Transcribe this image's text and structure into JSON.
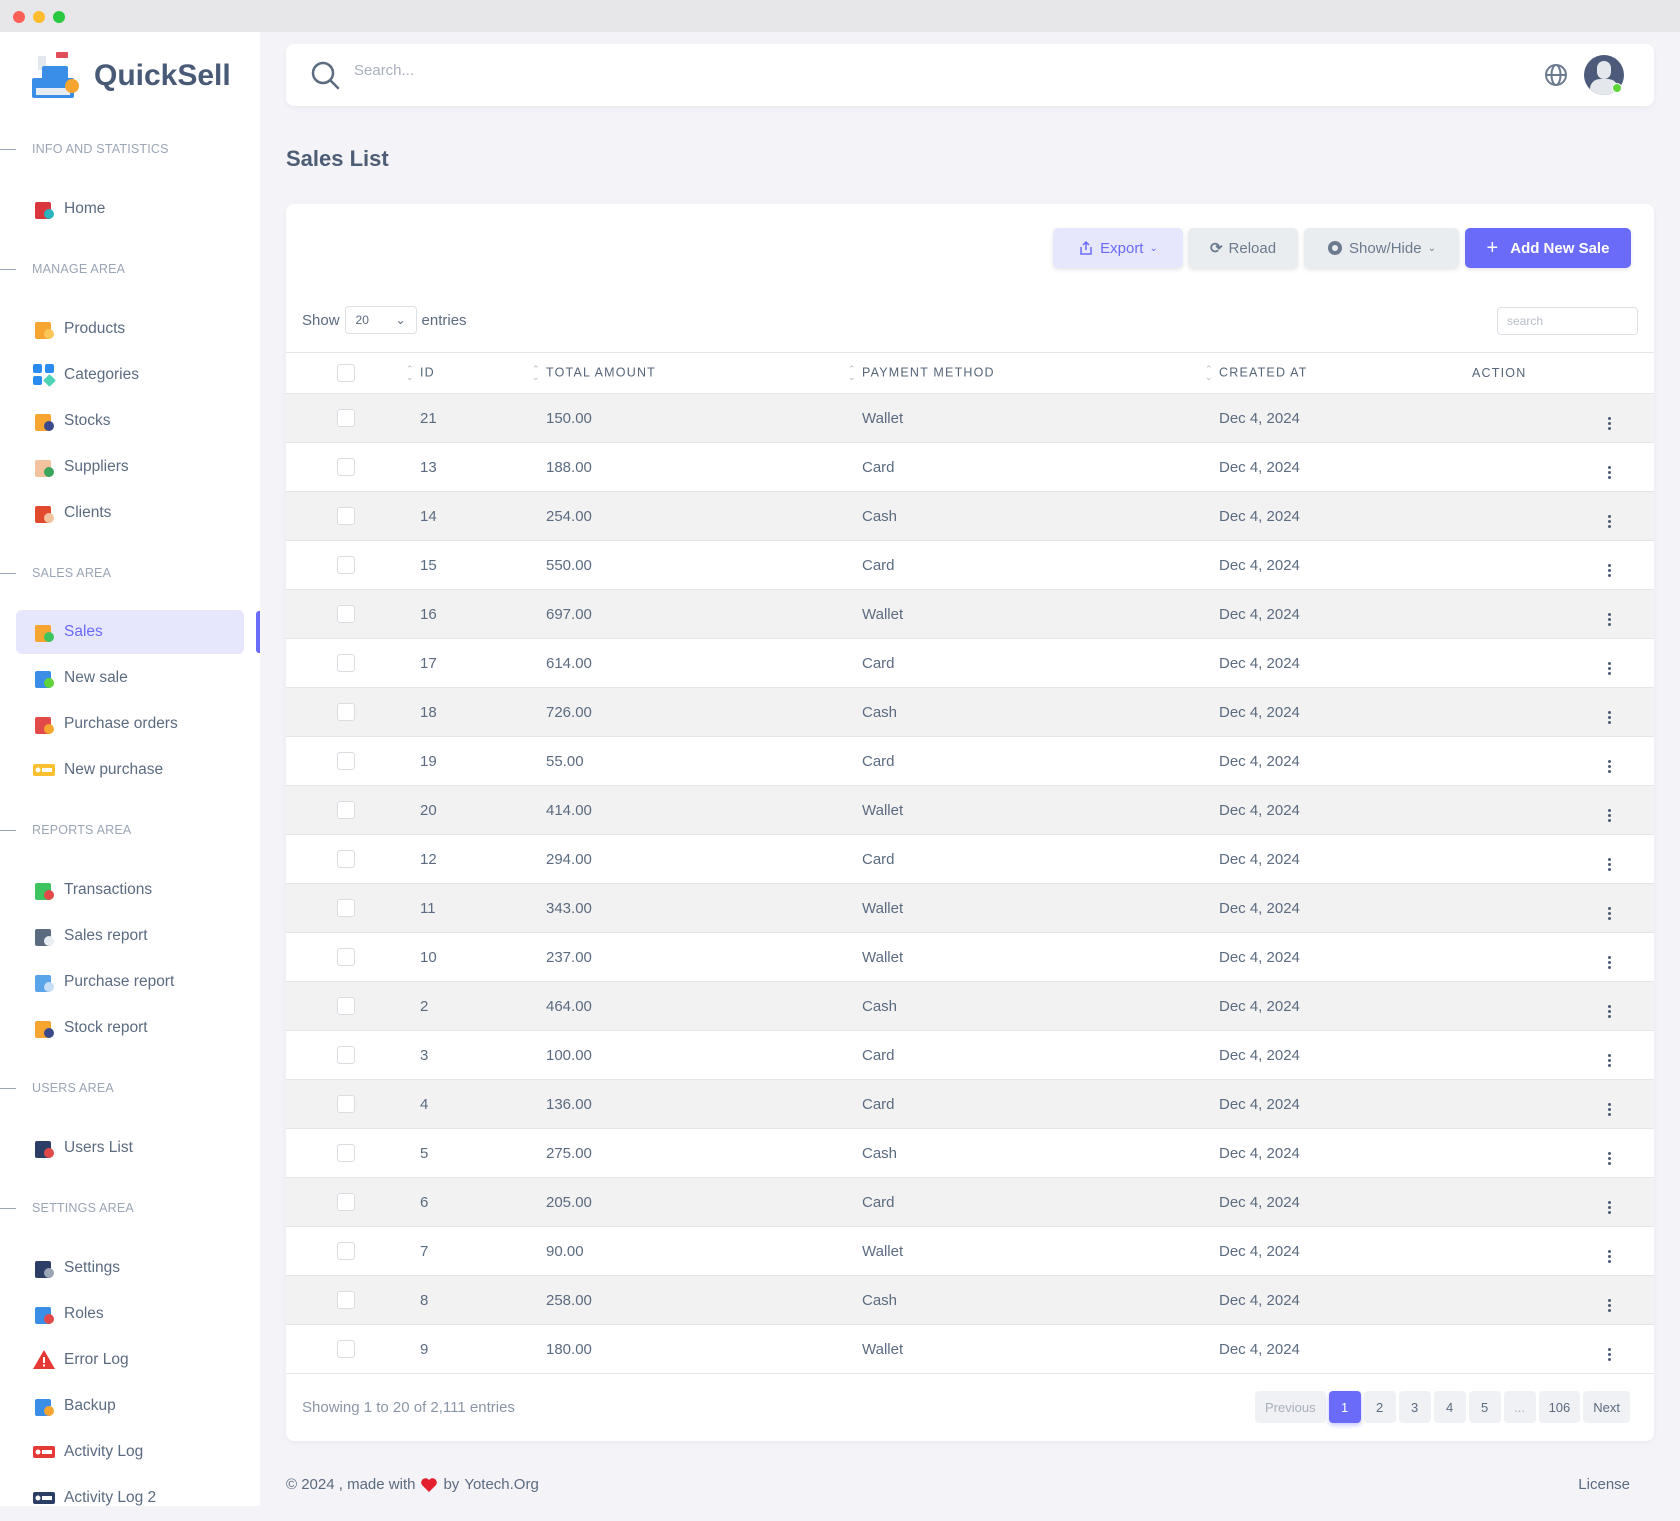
{
  "app": {
    "name": "QuickSell",
    "accent": "#6b6bfa"
  },
  "sidebar": {
    "sections": [
      {
        "label": "INFO AND STATISTICS",
        "items": [
          {
            "label": "Home",
            "icon": "store-icon"
          }
        ]
      },
      {
        "label": "MANAGE AREA",
        "items": [
          {
            "label": "Products",
            "icon": "shopping-bag-icon"
          },
          {
            "label": "Categories",
            "icon": "categories-icon"
          },
          {
            "label": "Stocks",
            "icon": "cart-icon"
          },
          {
            "label": "Suppliers",
            "icon": "supplier-icon"
          },
          {
            "label": "Clients",
            "icon": "client-icon"
          }
        ]
      },
      {
        "label": "SALES AREA",
        "items": [
          {
            "label": "Sales",
            "icon": "sales-box-icon",
            "active": true
          },
          {
            "label": "New sale",
            "icon": "cart-plus-icon"
          },
          {
            "label": "Purchase orders",
            "icon": "bags-icon"
          },
          {
            "label": "New purchase",
            "icon": "receipt-coin-icon"
          }
        ]
      },
      {
        "label": "REPORTS AREA",
        "items": [
          {
            "label": "Transactions",
            "icon": "transactions-icon"
          },
          {
            "label": "Sales report",
            "icon": "invoice-icon"
          },
          {
            "label": "Purchase report",
            "icon": "report-icon"
          },
          {
            "label": "Stock report",
            "icon": "cart-icon"
          }
        ]
      },
      {
        "label": "USERS AREA",
        "items": [
          {
            "label": "Users List",
            "icon": "users-icon"
          }
        ]
      },
      {
        "label": "SETTINGS AREA",
        "items": [
          {
            "label": "Settings",
            "icon": "settings-user-icon"
          },
          {
            "label": "Roles",
            "icon": "roles-icon"
          },
          {
            "label": "Error Log",
            "icon": "warning-icon"
          },
          {
            "label": "Backup",
            "icon": "backup-icon"
          },
          {
            "label": "Activity Log",
            "icon": "rec-icon"
          },
          {
            "label": "Activity Log 2",
            "icon": "rec-dark-icon"
          }
        ]
      }
    ]
  },
  "header": {
    "search_placeholder": "Search...",
    "status_color": "#5fd33a"
  },
  "page": {
    "title": "Sales List"
  },
  "toolbar": {
    "export": "Export",
    "reload": "Reload",
    "show_hide": "Show/Hide",
    "add": "Add New Sale"
  },
  "table": {
    "show_label": "Show",
    "page_size": "20",
    "entries_label": "entries",
    "search_placeholder": "search",
    "columns": [
      "ID",
      "TOTAL AMOUNT",
      "PAYMENT METHOD",
      "CREATED AT",
      "ACTION"
    ],
    "rows": [
      [
        "21",
        "150.00",
        "Wallet",
        "Dec 4, 2024"
      ],
      [
        "13",
        "188.00",
        "Card",
        "Dec 4, 2024"
      ],
      [
        "14",
        "254.00",
        "Cash",
        "Dec 4, 2024"
      ],
      [
        "15",
        "550.00",
        "Card",
        "Dec 4, 2024"
      ],
      [
        "16",
        "697.00",
        "Wallet",
        "Dec 4, 2024"
      ],
      [
        "17",
        "614.00",
        "Card",
        "Dec 4, 2024"
      ],
      [
        "18",
        "726.00",
        "Cash",
        "Dec 4, 2024"
      ],
      [
        "19",
        "55.00",
        "Card",
        "Dec 4, 2024"
      ],
      [
        "20",
        "414.00",
        "Wallet",
        "Dec 4, 2024"
      ],
      [
        "12",
        "294.00",
        "Card",
        "Dec 4, 2024"
      ],
      [
        "11",
        "343.00",
        "Wallet",
        "Dec 4, 2024"
      ],
      [
        "10",
        "237.00",
        "Wallet",
        "Dec 4, 2024"
      ],
      [
        "2",
        "464.00",
        "Cash",
        "Dec 4, 2024"
      ],
      [
        "3",
        "100.00",
        "Card",
        "Dec 4, 2024"
      ],
      [
        "4",
        "136.00",
        "Card",
        "Dec 4, 2024"
      ],
      [
        "5",
        "275.00",
        "Cash",
        "Dec 4, 2024"
      ],
      [
        "6",
        "205.00",
        "Card",
        "Dec 4, 2024"
      ],
      [
        "7",
        "90.00",
        "Wallet",
        "Dec 4, 2024"
      ],
      [
        "8",
        "258.00",
        "Cash",
        "Dec 4, 2024"
      ],
      [
        "9",
        "180.00",
        "Wallet",
        "Dec 4, 2024"
      ]
    ],
    "info": "Showing 1 to 20 of 2,111 entries",
    "pagination": {
      "previous": "Previous",
      "pages": [
        "1",
        "2",
        "3",
        "4",
        "5",
        "...",
        "106"
      ],
      "current": "1",
      "next": "Next"
    }
  },
  "footer": {
    "left_prefix": "© 2024 , made with",
    "left_suffix": "by",
    "link": "Yotech.Org",
    "license": "License"
  }
}
